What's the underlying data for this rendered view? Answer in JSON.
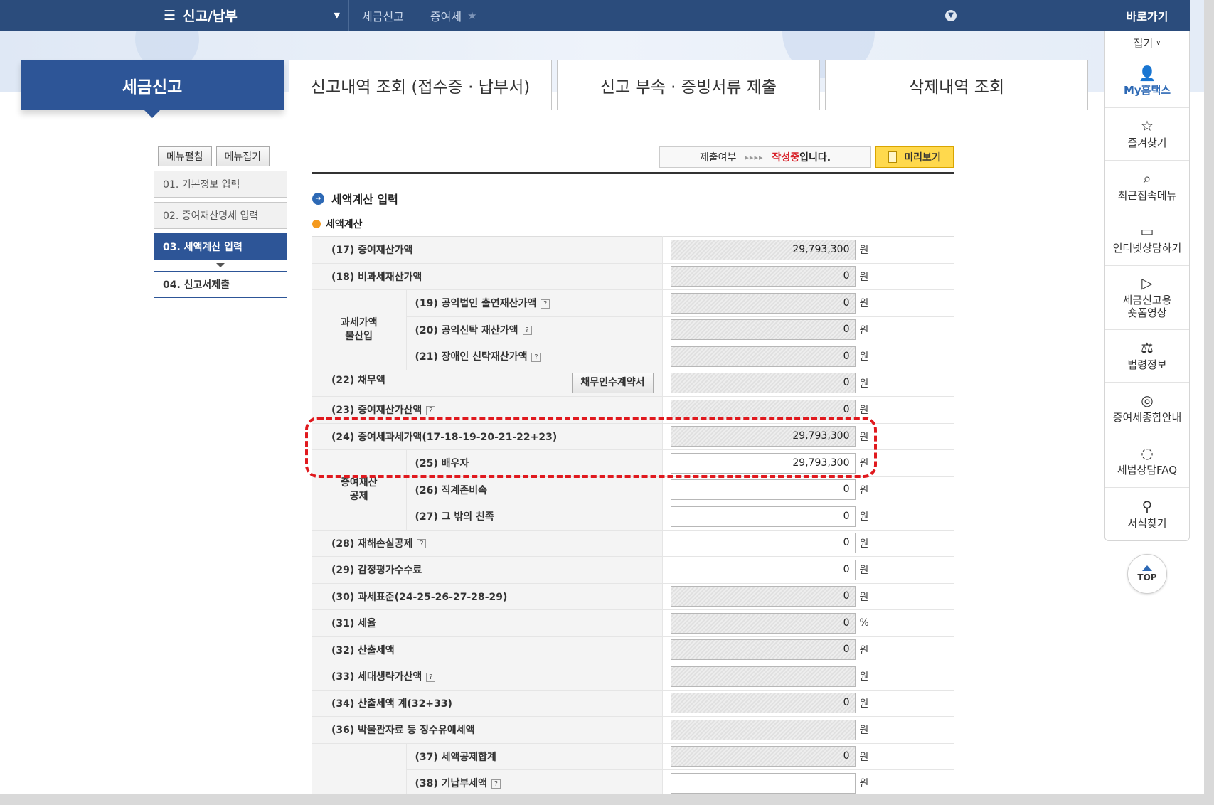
{
  "topbar": {
    "menu_icon": "hamburger-icon",
    "menu_label": "신고/납부",
    "breadcrumbs": [
      "세금신고",
      "증여세"
    ]
  },
  "tabs": [
    "세금신고",
    "신고내역 조회 (접수증 · 납부서)",
    "신고 부속 · 증빙서류 제출",
    "삭제내역 조회"
  ],
  "left_menu": {
    "edit_label": "메뉴펼침",
    "collapse_label": "메뉴접기",
    "steps": [
      "01. 기본정보 입력",
      "02. 증여재산명세 입력",
      "03. 세액계산 입력",
      "04. 신고서제출"
    ]
  },
  "status": {
    "label": "제출여부",
    "arrows": "▸▸▸▸",
    "state": "작성중",
    "suffix": "입니다.",
    "preview_label": "미리보기"
  },
  "section": {
    "title": "세액계산 입력",
    "subtitle": "세액계산"
  },
  "rows": {
    "r17": {
      "label": "(17) 증여재산가액",
      "value": "29,793,300",
      "unit": "원"
    },
    "r18": {
      "label": "(18) 비과세재산가액",
      "value": "0",
      "unit": "원"
    },
    "grp1": "과세가액\n불산입",
    "r19": {
      "label": "(19) 공익법인 출연재산가액",
      "value": "0",
      "unit": "원"
    },
    "r20": {
      "label": "(20) 공익신탁 재산가액",
      "value": "0",
      "unit": "원"
    },
    "r21": {
      "label": "(21) 장애인 신탁재산가액",
      "value": "0",
      "unit": "원"
    },
    "r22": {
      "label": "(22) 채무액",
      "button": "채무인수계약서",
      "value": "0",
      "unit": "원"
    },
    "r23": {
      "label": "(23) 증여재산가산액",
      "value": "0",
      "unit": "원"
    },
    "r24": {
      "label": "(24) 증여세과세가액(17-18-19-20-21-22+23)",
      "value": "29,793,300",
      "unit": "원"
    },
    "grp2": "증여재산\n공제",
    "r25": {
      "label": "(25) 배우자",
      "value": "29,793,300",
      "unit": "원"
    },
    "r26": {
      "label": "(26) 직계존비속",
      "value": "0",
      "unit": "원"
    },
    "r27": {
      "label": "(27) 그 밖의 친족",
      "value": "0",
      "unit": "원"
    },
    "r28": {
      "label": "(28) 재해손실공제",
      "value": "0",
      "unit": "원"
    },
    "r29": {
      "label": "(29) 감정평가수수료",
      "value": "0",
      "unit": "원"
    },
    "r30": {
      "label": "(30) 과세표준(24-25-26-27-28-29)",
      "value": "0",
      "unit": "원"
    },
    "r31": {
      "label": "(31) 세율",
      "value": "0",
      "unit": "%"
    },
    "r32": {
      "label": "(32) 산출세액",
      "value": "0",
      "unit": "원"
    },
    "r33": {
      "label": "(33) 세대생략가산액",
      "value": "",
      "unit": "원"
    },
    "r34": {
      "label": "(34) 산출세액 계(32+33)",
      "value": "0",
      "unit": "원"
    },
    "r36": {
      "label": "(36) 박물관자료 등 징수유예세액",
      "value": "",
      "unit": "원"
    },
    "r37": {
      "label": "(37) 세액공제합계",
      "value": "0",
      "unit": "원"
    },
    "r38": {
      "label": "(38) 기납부세액",
      "value": "",
      "unit": "원"
    }
  },
  "quick": {
    "title": "바로가기",
    "fold": "접기",
    "items": [
      {
        "label": "My홈택스",
        "icon": "user-icon"
      },
      {
        "label": "즐겨찾기",
        "icon": "star-icon"
      },
      {
        "label": "최근접속메뉴",
        "icon": "recent-search-icon"
      },
      {
        "label": "인터넷상담하기",
        "icon": "monitor-icon"
      },
      {
        "label": "세금신고용\n숏폼영상",
        "icon": "play-icon"
      },
      {
        "label": "법령정보",
        "icon": "gavel-icon"
      },
      {
        "label": "증여세종합안내",
        "icon": "coins-icon"
      },
      {
        "label": "세법상담FAQ",
        "icon": "chat-icon"
      },
      {
        "label": "서식찾기",
        "icon": "search-icon"
      }
    ],
    "top_label": "TOP"
  },
  "colors": {
    "primary": "#2d5597",
    "header": "#2b4c7c",
    "highlight": "#e0191e",
    "preview": "#ffd94d"
  }
}
